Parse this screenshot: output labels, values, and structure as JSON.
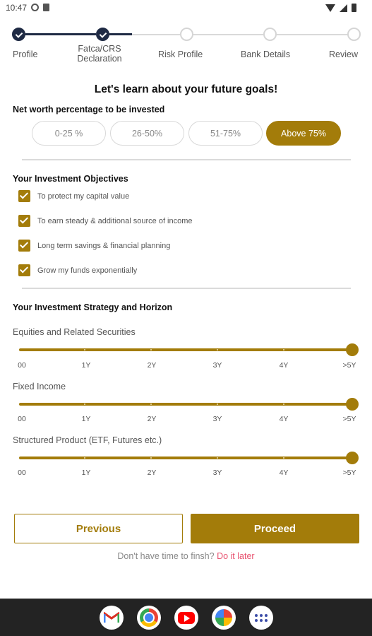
{
  "status_bar": {
    "time": "10:47"
  },
  "stepper": {
    "steps": [
      {
        "label": "Profile",
        "done": true
      },
      {
        "label": "Fatca/CRS\nDeclaration",
        "done": true
      },
      {
        "label": "Risk Profile",
        "done": false
      },
      {
        "label": "Bank Details",
        "done": false
      },
      {
        "label": "Review",
        "done": false
      }
    ]
  },
  "title": "Let's learn about your future goals!",
  "net_worth": {
    "heading": "Net worth percentage to be invested",
    "options": [
      "0-25 %",
      "26-50%",
      "51-75%",
      "Above 75%"
    ],
    "selected": "Above 75%"
  },
  "objectives": {
    "heading": "Your Investment Objectives",
    "items": [
      {
        "label": "To protect my capital value",
        "checked": true
      },
      {
        "label": "To earn steady & additional source of income",
        "checked": true
      },
      {
        "label": "Long term savings & financial planning",
        "checked": true
      },
      {
        "label": "Grow my funds exponentially",
        "checked": true
      }
    ]
  },
  "strategy": {
    "heading": "Your Investment Strategy and Horizon",
    "tick_labels": [
      "00",
      "1Y",
      "2Y",
      "3Y",
      "4Y",
      ">5Y"
    ],
    "sliders": [
      {
        "label": "Equities and Related Securities",
        "value": ">5Y"
      },
      {
        "label": "Fixed Income",
        "value": ">5Y"
      },
      {
        "label": "Structured Product (ETF, Futures etc.)",
        "value": ">5Y"
      }
    ]
  },
  "buttons": {
    "previous": "Previous",
    "proceed": "Proceed"
  },
  "later": {
    "text": "Don't have time to finsh?",
    "link": "Do it later"
  },
  "colors": {
    "accent": "#a37c0a",
    "stepper_done": "#1f2a44",
    "link": "#e8526f"
  },
  "dock": {
    "apps": [
      "gmail-icon",
      "chrome-icon",
      "youtube-icon",
      "photos-icon",
      "app-drawer-icon"
    ]
  }
}
